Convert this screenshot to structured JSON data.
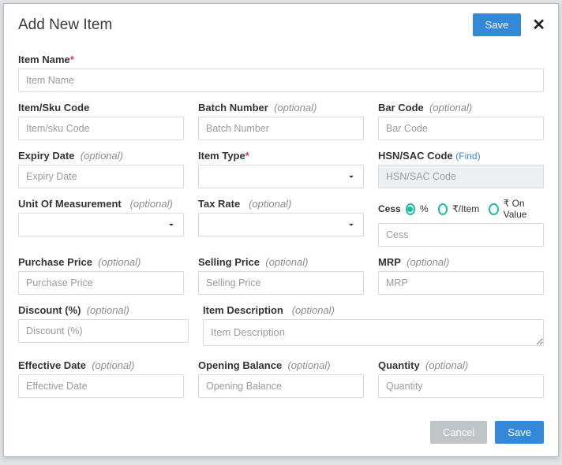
{
  "header": {
    "title": "Add New Item",
    "save": "Save",
    "close_glyph": "✕"
  },
  "labels": {
    "item_name": "Item Name",
    "sku": "Item/Sku Code",
    "batch": "Batch Number",
    "barcode": "Bar Code",
    "expiry": "Expiry Date",
    "item_type": "Item Type",
    "hsn": "HSN/SAC Code",
    "find": "(Find)",
    "uom": "Unit Of Measurement",
    "tax": "Tax Rate",
    "cess": "Cess",
    "purchase": "Purchase Price",
    "selling": "Selling Price",
    "mrp": "MRP",
    "discount": "Discount (%)",
    "desc": "Item Description",
    "eff_date": "Effective Date",
    "open_bal": "Opening Balance",
    "qty": "Quantity",
    "optional": "(optional)",
    "required": "*"
  },
  "placeholders": {
    "item_name": "Item Name",
    "sku": "Item/sku Code",
    "batch": "Batch Number",
    "barcode": "Bar Code",
    "expiry": "Expiry Date",
    "hsn": "HSN/SAC Code",
    "cess": "Cess",
    "purchase": "Purchase Price",
    "selling": "Selling Price",
    "mrp": "MRP",
    "discount": "Discount (%)",
    "desc": "Item Description",
    "eff_date": "Effective Date",
    "open_bal": "Opening Balance",
    "qty": "Quantity"
  },
  "cess_opts": {
    "pct": "%",
    "per_item": "₹/Item",
    "on_value": "₹ On Value",
    "selected": "pct"
  },
  "footer": {
    "cancel": "Cancel",
    "save": "Save"
  }
}
